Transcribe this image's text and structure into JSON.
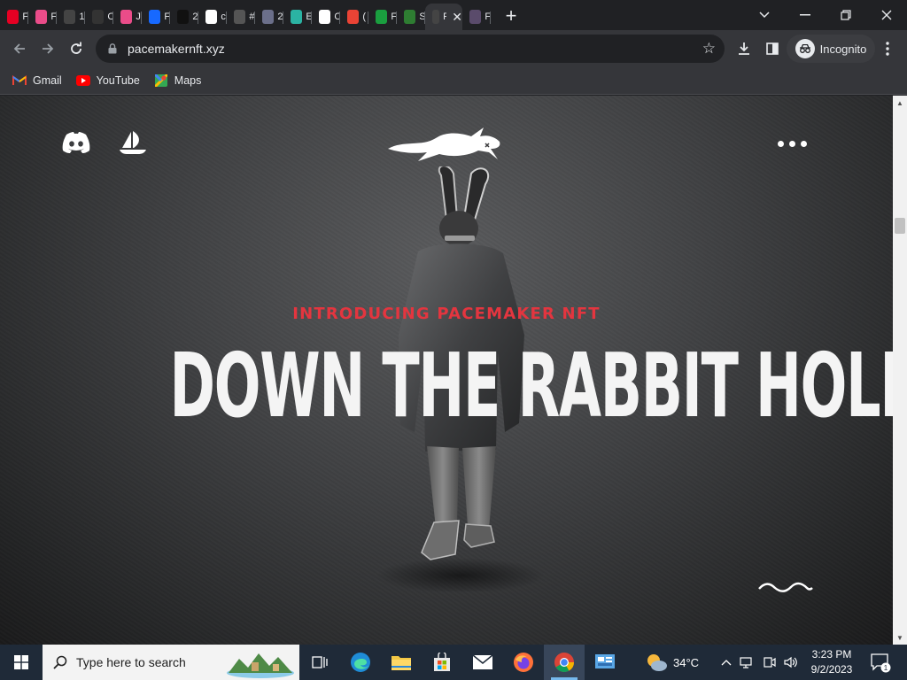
{
  "browser": {
    "tabs": [
      {
        "icon": "pinterest-icon",
        "label": "F",
        "color": "#e60023"
      },
      {
        "icon": "dribbble-icon",
        "label": "F",
        "color": "#ea4c89"
      },
      {
        "icon": "rainbow-logo-icon",
        "label": "1",
        "color": "#444"
      },
      {
        "icon": "circle-logo-icon",
        "label": "C",
        "color": "#333"
      },
      {
        "icon": "dribbble-icon",
        "label": "J",
        "color": "#ea4c89"
      },
      {
        "icon": "behance-icon",
        "label": "F",
        "color": "#1769ff"
      },
      {
        "icon": "dark-logo-icon",
        "label": "2",
        "color": "#111"
      },
      {
        "icon": "google-icon",
        "label": "c",
        "color": "#ffffff"
      },
      {
        "icon": "gray-logo-icon",
        "label": "#",
        "color": "#555"
      },
      {
        "icon": "w-logo-icon",
        "label": "2",
        "color": "#6b6f8a"
      },
      {
        "icon": "d-logo-icon",
        "label": "E",
        "color": "#2bb3a3"
      },
      {
        "icon": "cube-logo-icon",
        "label": "C",
        "color": "#ffffff"
      },
      {
        "icon": "gmail-icon",
        "label": "(",
        "color": "#ea4335"
      },
      {
        "icon": "w-green-icon",
        "label": "F",
        "color": "#1a9e3f"
      },
      {
        "icon": "character-icon",
        "label": "S",
        "color": "#2e7d32"
      },
      {
        "icon": "pacemaker-favicon-icon",
        "label": "P",
        "color": "#444"
      },
      {
        "icon": "image-favicon-icon",
        "label": "F",
        "color": "#5a4b6b"
      }
    ],
    "active_tab_index": 15,
    "new_tab_label": "+",
    "url": "pacemakernft.xyz",
    "incognito_label": "Incognito",
    "bookmarks": [
      {
        "label": "Gmail",
        "icon": "gmail-icon"
      },
      {
        "label": "YouTube",
        "icon": "youtube-icon"
      },
      {
        "label": "Maps",
        "icon": "maps-icon"
      }
    ]
  },
  "site": {
    "eyebrow": "INTRODUCING PACEMAKER NFT",
    "headline": "DOWN THE RABBIT HOLE"
  },
  "taskbar": {
    "search_placeholder": "Type here to search",
    "temperature": "34°C",
    "time": "3:23 PM",
    "date": "9/2/2023",
    "notification_count": "1"
  }
}
